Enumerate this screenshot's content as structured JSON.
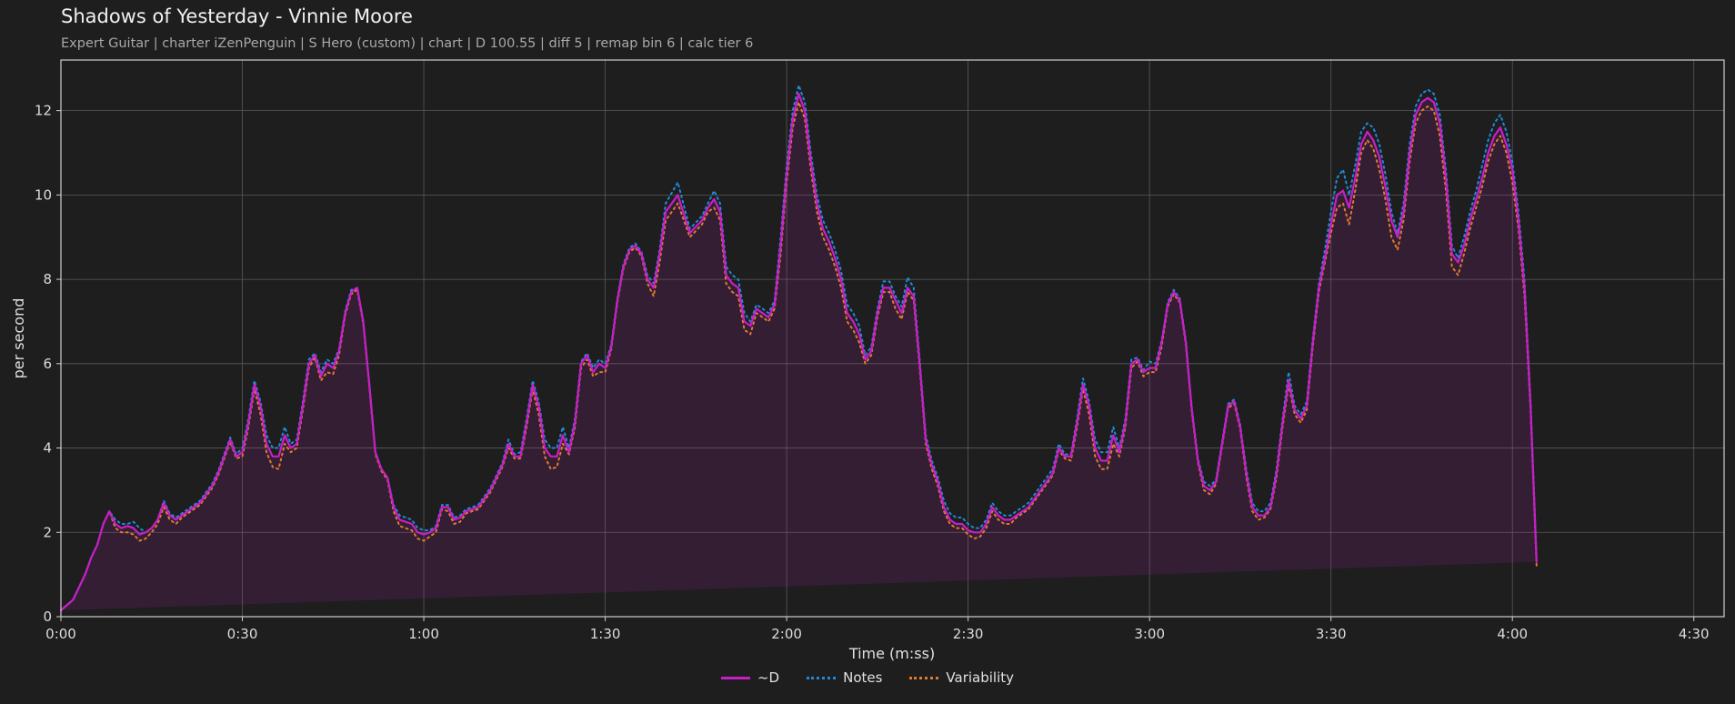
{
  "header": {
    "title": "Shadows of Yesterday - Vinnie Moore",
    "subtitle": "Expert Guitar  |  charter iZenPenguin  |  S Hero (custom)  |  chart  |  D 100.55  |  diff 5  |  remap bin 6  |  calc tier 6"
  },
  "chart_data": {
    "type": "area",
    "xlabel": "Time (m:ss)",
    "ylabel": "per second",
    "xlim": [
      0,
      275
    ],
    "ylim": [
      0,
      13.2
    ],
    "grid": true,
    "legend_position": "bottom-center",
    "x_ticks": [
      0,
      30,
      60,
      90,
      120,
      150,
      180,
      210,
      240,
      270
    ],
    "x_tick_labels": [
      "0:00",
      "0:30",
      "1:00",
      "1:30",
      "2:00",
      "2:30",
      "3:00",
      "3:30",
      "4:00",
      "4:30"
    ],
    "y_ticks": [
      0,
      2,
      4,
      6,
      8,
      10,
      12
    ],
    "y_tick_labels": [
      "0",
      "2",
      "4",
      "6",
      "8",
      "10",
      "12"
    ],
    "x": [
      0,
      2,
      4,
      5,
      6,
      7,
      8,
      9,
      10,
      11,
      12,
      13,
      14,
      15,
      16,
      17,
      18,
      19,
      20,
      21,
      22,
      23,
      24,
      25,
      26,
      27,
      28,
      29,
      30,
      31,
      32,
      33,
      34,
      35,
      36,
      37,
      38,
      39,
      40,
      41,
      42,
      43,
      44,
      45,
      46,
      47,
      48,
      49,
      50,
      51,
      52,
      53,
      54,
      55,
      56,
      57,
      58,
      59,
      60,
      61,
      62,
      63,
      64,
      65,
      66,
      67,
      68,
      69,
      70,
      71,
      72,
      73,
      74,
      75,
      76,
      77,
      78,
      79,
      80,
      81,
      82,
      83,
      84,
      85,
      86,
      87,
      88,
      89,
      90,
      91,
      92,
      93,
      94,
      95,
      96,
      97,
      98,
      99,
      100,
      102,
      104,
      106,
      107,
      108,
      109,
      110,
      111,
      112,
      113,
      114,
      115,
      116,
      117,
      118,
      119,
      120,
      121,
      122,
      123,
      124,
      125,
      126,
      127,
      128,
      129,
      130,
      131,
      132,
      133,
      134,
      135,
      136,
      137,
      138,
      139,
      140,
      141,
      142,
      143,
      144,
      145,
      146,
      147,
      148,
      149,
      150,
      151,
      152,
      153,
      154,
      155,
      156,
      157,
      158,
      159,
      160,
      161,
      162,
      163,
      164,
      165,
      166,
      167,
      168,
      169,
      170,
      171,
      172,
      173,
      174,
      175,
      176,
      177,
      178,
      179,
      180,
      181,
      182,
      183,
      184,
      185,
      186,
      187,
      188,
      189,
      190,
      191,
      192,
      193,
      194,
      195,
      196,
      197,
      198,
      199,
      200,
      201,
      202,
      203,
      204,
      205,
      206,
      207,
      208,
      209,
      210,
      211,
      212,
      213,
      214,
      215,
      216,
      217,
      218,
      219,
      220,
      221,
      222,
      223,
      224,
      225,
      226,
      227,
      228,
      229,
      230,
      231,
      232,
      233,
      234,
      235,
      236,
      237,
      238,
      239,
      240,
      241,
      242,
      243,
      244,
      245,
      246,
      247,
      248,
      249,
      250,
      251,
      252,
      253,
      254,
      255,
      256,
      257,
      258,
      259,
      260,
      261,
      262,
      263,
      264,
      265,
      266,
      267,
      268,
      269,
      270,
      271,
      272,
      273,
      274,
      275
    ],
    "series": [
      {
        "name": "~D",
        "color": "#c81ec8",
        "values": [
          0.15,
          0.4,
          1.0,
          1.4,
          1.7,
          2.2,
          2.5,
          2.2,
          2.1,
          2.15,
          2.1,
          1.95,
          2.0,
          2.1,
          2.3,
          2.7,
          2.4,
          2.3,
          2.4,
          2.5,
          2.6,
          2.7,
          2.9,
          3.1,
          3.4,
          3.8,
          4.2,
          3.8,
          3.9,
          4.6,
          5.5,
          5.0,
          4.1,
          3.8,
          3.8,
          4.3,
          4.0,
          4.1,
          5.0,
          6.0,
          6.2,
          5.7,
          6.0,
          5.9,
          6.3,
          7.2,
          7.7,
          7.8,
          7.0,
          5.5,
          3.9,
          3.5,
          3.3,
          2.6,
          2.3,
          2.25,
          2.2,
          2.0,
          1.95,
          2.0,
          2.1,
          2.6,
          2.6,
          2.3,
          2.35,
          2.5,
          2.55,
          2.6,
          2.8,
          3.0,
          3.3,
          3.6,
          4.1,
          3.8,
          3.8,
          4.6,
          5.5,
          5.0,
          4.0,
          3.8,
          3.8,
          4.3,
          3.9,
          4.6,
          6.0,
          6.2,
          5.8,
          6.0,
          5.9,
          6.4,
          7.5,
          8.3,
          8.7,
          8.8,
          8.6,
          8.0,
          7.8,
          8.6,
          9.6,
          10.0,
          9.1,
          9.4,
          9.7,
          9.9,
          9.6,
          8.1,
          7.9,
          7.8,
          7.0,
          6.9,
          7.3,
          7.2,
          7.1,
          7.4,
          8.8,
          10.5,
          11.8,
          12.4,
          12.0,
          10.8,
          9.8,
          9.2,
          8.9,
          8.5,
          8.0,
          7.2,
          7.0,
          6.7,
          6.1,
          6.3,
          7.2,
          7.8,
          7.8,
          7.5,
          7.2,
          7.8,
          7.6,
          6.0,
          4.2,
          3.6,
          3.2,
          2.6,
          2.3,
          2.2,
          2.2,
          2.05,
          2.0,
          2.0,
          2.2,
          2.6,
          2.4,
          2.3,
          2.3,
          2.4,
          2.5,
          2.6,
          2.8,
          3.0,
          3.2,
          3.4,
          4.0,
          3.8,
          3.8,
          4.6,
          5.5,
          5.0,
          4.0,
          3.7,
          3.7,
          4.3,
          3.9,
          4.6,
          6.0,
          6.1,
          5.8,
          5.9,
          5.9,
          6.5,
          7.4,
          7.7,
          7.5,
          6.5,
          4.9,
          3.7,
          3.1,
          3.0,
          3.2,
          4.1,
          5.0,
          5.1,
          4.5,
          3.4,
          2.6,
          2.4,
          2.4,
          2.6,
          3.4,
          4.6,
          5.6,
          4.9,
          4.7,
          5.0,
          6.5,
          7.8,
          8.5,
          9.3,
          10.0,
          10.1,
          9.7,
          10.4,
          11.2,
          11.5,
          11.3,
          10.9,
          10.2,
          9.4,
          9.0,
          9.6,
          11.0,
          11.9,
          12.2,
          12.3,
          12.2,
          11.7,
          10.4,
          8.6,
          8.4,
          8.8,
          9.4,
          9.9,
          10.4,
          11.0,
          11.4,
          11.6,
          11.2,
          10.6,
          9.4,
          7.8,
          5.0,
          1.3
        ]
      },
      {
        "name": "Notes",
        "color": "#1f8ad6",
        "values": [
          0.15,
          0.4,
          1.0,
          1.4,
          1.7,
          2.2,
          2.5,
          2.3,
          2.2,
          2.2,
          2.25,
          2.1,
          2.0,
          2.1,
          2.3,
          2.75,
          2.45,
          2.35,
          2.45,
          2.55,
          2.65,
          2.75,
          2.95,
          3.15,
          3.45,
          3.85,
          4.25,
          3.85,
          4.0,
          4.7,
          5.6,
          5.1,
          4.3,
          4.0,
          4.0,
          4.5,
          4.1,
          4.2,
          5.1,
          6.1,
          6.25,
          5.8,
          6.1,
          6.0,
          6.35,
          7.25,
          7.75,
          7.8,
          7.0,
          5.5,
          3.9,
          3.5,
          3.3,
          2.65,
          2.4,
          2.35,
          2.3,
          2.1,
          2.05,
          2.05,
          2.15,
          2.65,
          2.65,
          2.35,
          2.4,
          2.55,
          2.6,
          2.65,
          2.85,
          3.05,
          3.35,
          3.65,
          4.2,
          3.85,
          3.9,
          4.7,
          5.6,
          5.1,
          4.2,
          4.0,
          4.0,
          4.5,
          4.0,
          4.7,
          6.05,
          6.25,
          5.9,
          6.1,
          6.0,
          6.45,
          7.55,
          8.35,
          8.75,
          8.85,
          8.65,
          8.1,
          7.9,
          8.7,
          9.8,
          10.3,
          9.2,
          9.5,
          9.8,
          10.1,
          9.8,
          8.3,
          8.1,
          8.0,
          7.2,
          7.0,
          7.4,
          7.3,
          7.2,
          7.5,
          9.0,
          10.7,
          12.0,
          12.6,
          12.2,
          11.0,
          10.0,
          9.4,
          9.1,
          8.7,
          8.2,
          7.4,
          7.2,
          6.9,
          6.2,
          6.4,
          7.3,
          7.95,
          7.95,
          7.6,
          7.35,
          8.05,
          7.8,
          6.1,
          4.3,
          3.7,
          3.3,
          2.75,
          2.45,
          2.35,
          2.35,
          2.2,
          2.1,
          2.1,
          2.3,
          2.7,
          2.5,
          2.4,
          2.4,
          2.5,
          2.6,
          2.7,
          2.9,
          3.1,
          3.3,
          3.5,
          4.1,
          3.85,
          3.85,
          4.7,
          5.65,
          5.1,
          4.2,
          3.9,
          3.9,
          4.5,
          4.0,
          4.7,
          6.1,
          6.15,
          5.85,
          6.05,
          6.0,
          6.55,
          7.45,
          7.75,
          7.55,
          6.55,
          4.95,
          3.75,
          3.2,
          3.1,
          3.25,
          4.15,
          5.05,
          5.15,
          4.55,
          3.5,
          2.7,
          2.5,
          2.5,
          2.7,
          3.5,
          4.7,
          5.8,
          5.0,
          4.8,
          5.1,
          6.6,
          7.9,
          8.7,
          9.6,
          10.4,
          10.6,
          10.0,
          10.7,
          11.5,
          11.7,
          11.6,
          11.2,
          10.5,
          9.6,
          9.1,
          9.8,
          11.2,
          12.1,
          12.4,
          12.5,
          12.4,
          11.9,
          10.6,
          8.8,
          8.5,
          9.0,
          9.6,
          10.1,
          10.7,
          11.3,
          11.7,
          11.9,
          11.5,
          10.8,
          9.6,
          8.0,
          5.1,
          1.4
        ]
      },
      {
        "name": "Variability",
        "color": "#e07a2e",
        "values": [
          0.15,
          0.4,
          1.0,
          1.4,
          1.7,
          2.2,
          2.5,
          2.1,
          2.0,
          2.0,
          1.95,
          1.8,
          1.85,
          2.0,
          2.2,
          2.6,
          2.3,
          2.2,
          2.35,
          2.45,
          2.55,
          2.65,
          2.85,
          3.05,
          3.35,
          3.75,
          4.15,
          3.75,
          3.8,
          4.5,
          5.4,
          4.8,
          3.9,
          3.55,
          3.5,
          4.1,
          3.9,
          4.0,
          4.9,
          5.9,
          6.15,
          5.6,
          5.8,
          5.75,
          6.2,
          7.15,
          7.65,
          7.75,
          6.95,
          5.45,
          3.85,
          3.45,
          3.25,
          2.5,
          2.15,
          2.1,
          2.05,
          1.85,
          1.8,
          1.9,
          2.0,
          2.55,
          2.5,
          2.2,
          2.25,
          2.45,
          2.5,
          2.55,
          2.75,
          2.95,
          3.25,
          3.55,
          4.0,
          3.75,
          3.75,
          4.5,
          5.4,
          4.8,
          3.8,
          3.5,
          3.55,
          4.1,
          3.85,
          4.5,
          5.9,
          6.1,
          5.7,
          5.8,
          5.8,
          6.35,
          7.45,
          8.25,
          8.65,
          8.75,
          8.55,
          7.9,
          7.6,
          8.4,
          9.4,
          9.8,
          9.0,
          9.3,
          9.6,
          9.7,
          9.4,
          7.9,
          7.7,
          7.6,
          6.8,
          6.7,
          7.2,
          7.1,
          7.0,
          7.3,
          8.6,
          10.3,
          11.6,
          12.2,
          11.8,
          10.6,
          9.6,
          9.0,
          8.7,
          8.3,
          7.8,
          7.0,
          6.8,
          6.5,
          6.0,
          6.2,
          7.1,
          7.7,
          7.7,
          7.3,
          7.05,
          7.7,
          7.5,
          5.9,
          4.1,
          3.5,
          3.1,
          2.5,
          2.2,
          2.1,
          2.1,
          1.95,
          1.85,
          1.9,
          2.1,
          2.5,
          2.3,
          2.2,
          2.2,
          2.35,
          2.45,
          2.55,
          2.75,
          2.95,
          3.15,
          3.35,
          3.95,
          3.75,
          3.7,
          4.5,
          5.4,
          4.8,
          3.8,
          3.5,
          3.5,
          4.1,
          3.8,
          4.5,
          5.9,
          6.05,
          5.7,
          5.8,
          5.8,
          6.4,
          7.35,
          7.65,
          7.45,
          6.45,
          4.85,
          3.65,
          3.0,
          2.9,
          3.15,
          4.05,
          4.95,
          5.05,
          4.45,
          3.3,
          2.5,
          2.3,
          2.35,
          2.55,
          3.3,
          4.5,
          5.5,
          4.8,
          4.6,
          4.9,
          6.4,
          7.7,
          8.4,
          9.1,
          9.7,
          9.8,
          9.3,
          10.1,
          11.0,
          11.3,
          11.1,
          10.6,
          9.9,
          9.0,
          8.7,
          9.4,
          10.8,
          11.7,
          12.0,
          12.1,
          12.0,
          11.4,
          10.1,
          8.3,
          8.1,
          8.6,
          9.2,
          9.7,
          10.2,
          10.8,
          11.2,
          11.4,
          11.0,
          10.3,
          9.2,
          7.6,
          4.9,
          1.2
        ]
      }
    ]
  }
}
